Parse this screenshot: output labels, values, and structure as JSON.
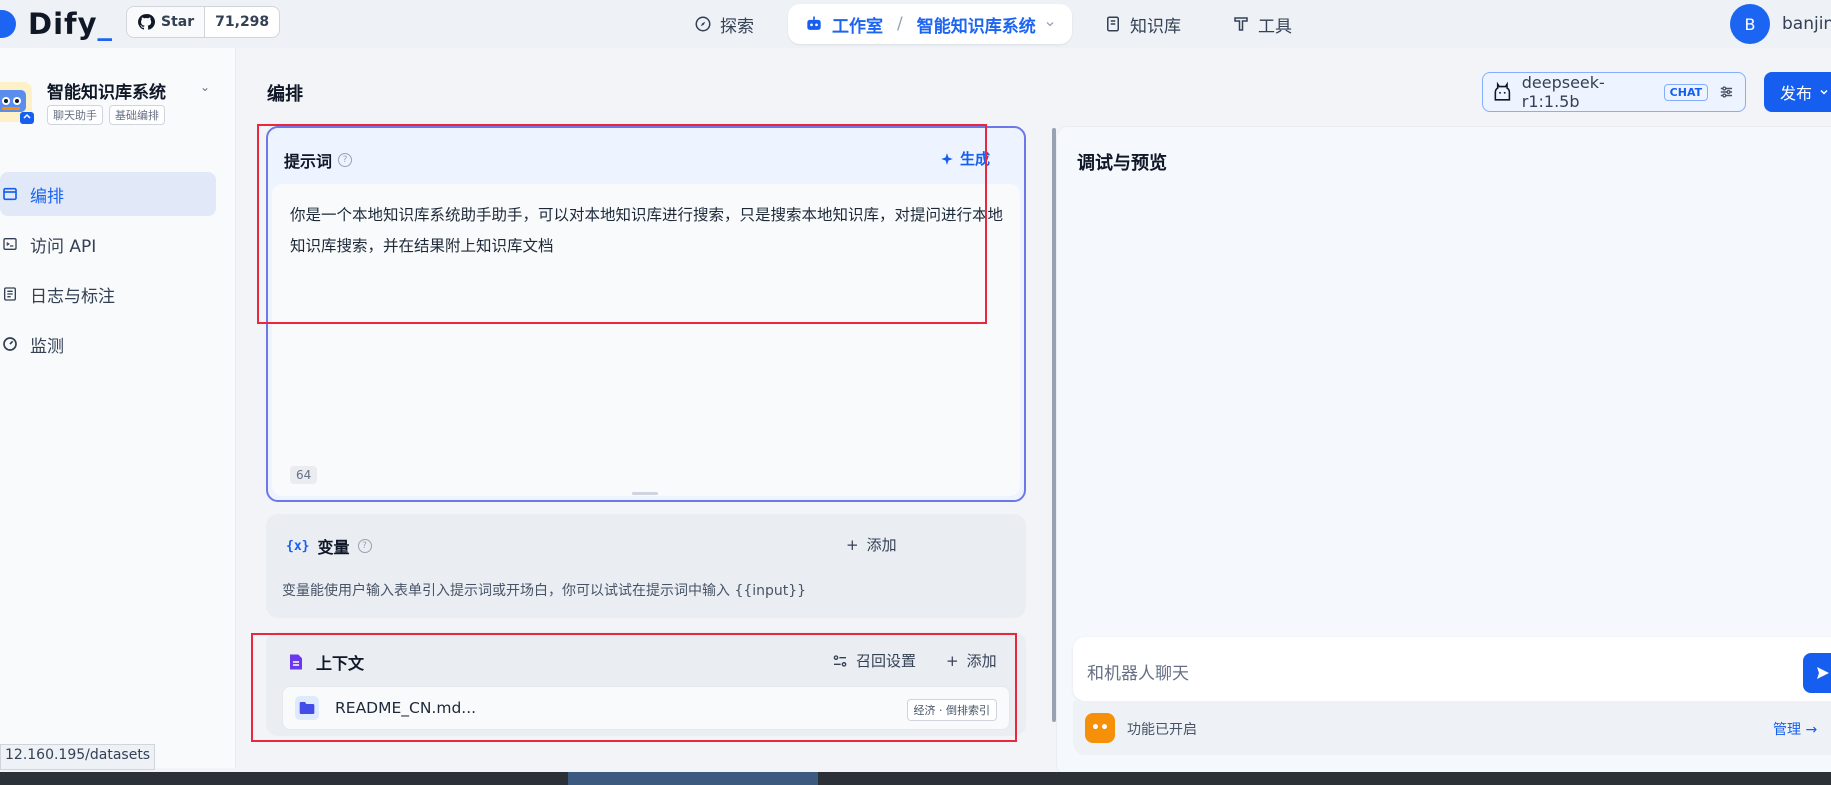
{
  "header": {
    "logo": "Dify",
    "github": {
      "star_label": "Star",
      "count": "71,298"
    },
    "nav": {
      "explore": "探索",
      "studio": "工作室",
      "separator": "/",
      "app": "智能知识库系统",
      "knowledge": "知识库",
      "tools": "工具"
    },
    "user": {
      "initial": "B",
      "name": "banjin"
    }
  },
  "sidebar": {
    "app_name": "智能知识库系统",
    "tags": [
      "聊天助手",
      "基础编排"
    ],
    "items": [
      {
        "label": "编排",
        "icon": "layout-icon",
        "active": true
      },
      {
        "label": "访问 API",
        "icon": "terminal-icon",
        "active": false
      },
      {
        "label": "日志与标注",
        "icon": "file-list-icon",
        "active": false
      },
      {
        "label": "监测",
        "icon": "dashboard-icon",
        "active": false
      }
    ]
  },
  "main": {
    "title": "编排",
    "model": {
      "name": "deepseek-r1:1.5b",
      "badge": "CHAT"
    },
    "publish": "发布"
  },
  "prompt": {
    "title": "提示词",
    "generate": "生成",
    "text": "你是一个本地知识库系统助手助手，可以对本地知识库进行搜索，只是搜索本地知识库，对提问进行本地知识库搜索，并在结果附上知识库文档",
    "count": "64"
  },
  "variables": {
    "icon": "{x}",
    "title": "变量",
    "add": "添加",
    "description": "变量能使用户输入表单引入提示词或开场白，你可以试试在提示词中输入 {{input}}"
  },
  "context": {
    "title": "上下文",
    "recall": "召回设置",
    "add": "添加",
    "file": {
      "name": "README_CN.md...",
      "badge": "经济 · 倒排索引"
    }
  },
  "debug": {
    "title": "调试与预览",
    "chat_placeholder": "和机器人聊天",
    "features": "功能已开启",
    "manage": "管理 →"
  },
  "status_url": "12.160.195/datasets",
  "colors": {
    "accent": "#155eef",
    "highlight": "#e8293d"
  }
}
